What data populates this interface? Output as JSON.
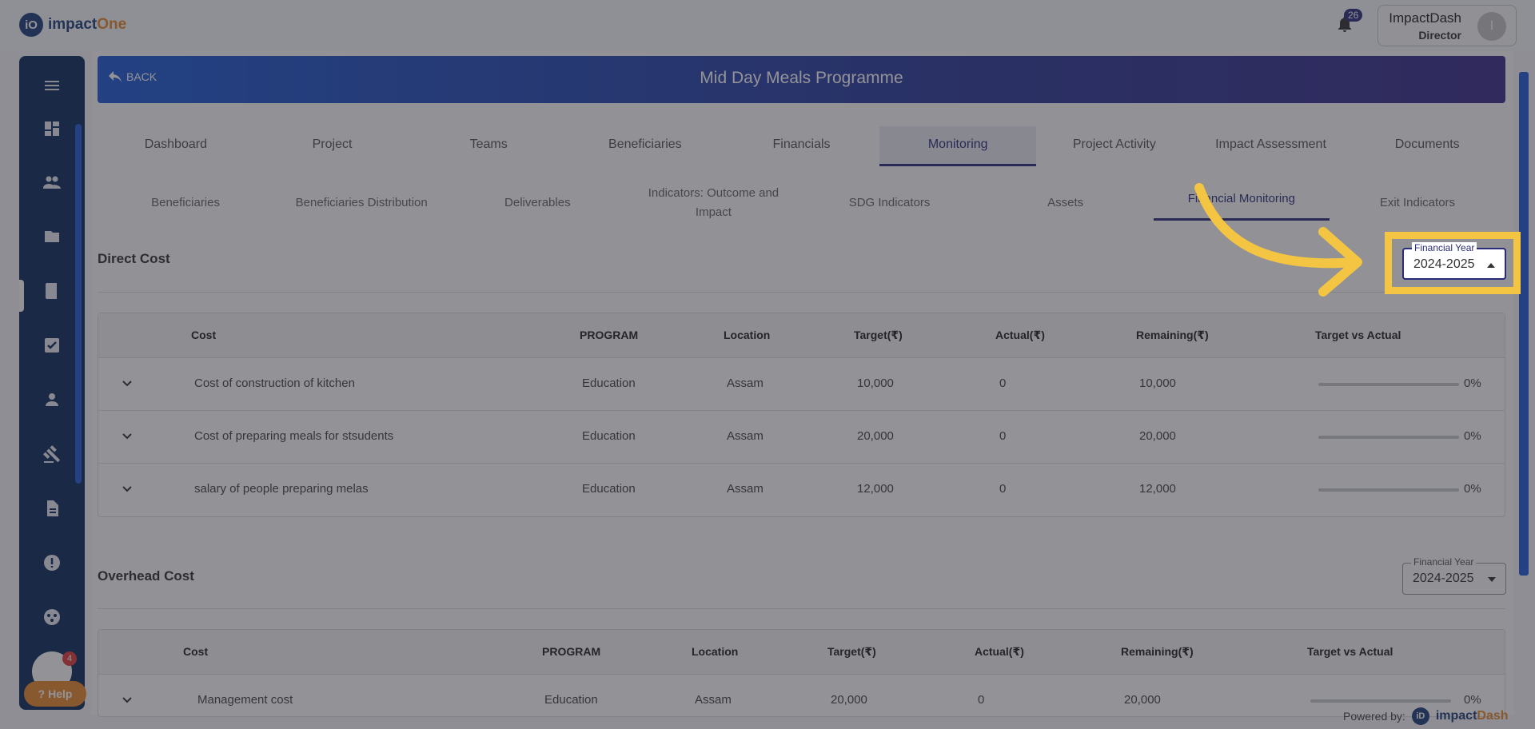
{
  "brand": {
    "logo_initials": "iO",
    "name_part1": "impact",
    "name_part2": "One"
  },
  "topbar": {
    "notification_count": "26",
    "user_name": "ImpactDash",
    "user_role": "Director",
    "avatar_initial": "I"
  },
  "sidebar": {
    "items": [
      "menu-icon",
      "dashboard-icon",
      "users-icon",
      "folder-icon",
      "book-icon",
      "checkbox-icon",
      "person-icon",
      "gavel-icon",
      "document-icon",
      "alert-icon",
      "network-icon"
    ],
    "notification_count": "4",
    "help_label": "Help"
  },
  "header": {
    "back_label": "BACK",
    "title": "Mid Day Meals Programme"
  },
  "main_tabs": [
    {
      "label": "Dashboard"
    },
    {
      "label": "Project"
    },
    {
      "label": "Teams"
    },
    {
      "label": "Beneficiaries"
    },
    {
      "label": "Financials"
    },
    {
      "label": "Monitoring",
      "active": true
    },
    {
      "label": "Project Activity"
    },
    {
      "label": "Impact Assessment"
    },
    {
      "label": "Documents"
    }
  ],
  "sub_tabs": [
    {
      "label": "Beneficiaries"
    },
    {
      "label": "Beneficiaries Distribution"
    },
    {
      "label": "Deliverables"
    },
    {
      "label": "Indicators: Outcome and Impact"
    },
    {
      "label": "SDG Indicators"
    },
    {
      "label": "Assets"
    },
    {
      "label": "Financial Monitoring",
      "active": true
    },
    {
      "label": "Exit Indicators"
    }
  ],
  "direct_cost": {
    "title": "Direct Cost",
    "fy_label": "Financial Year",
    "fy_value": "2024-2025",
    "columns": [
      "Cost",
      "PROGRAM",
      "Location",
      "Target(₹)",
      "Actual(₹)",
      "Remaining(₹)",
      "Target vs Actual"
    ],
    "rows": [
      {
        "cost": "Cost of construction of kitchen",
        "program": "Education",
        "location": "Assam",
        "target": "10,000",
        "actual": "0",
        "remaining": "10,000",
        "progress": 0,
        "progress_label": "0%"
      },
      {
        "cost": "Cost of preparing meals for stsudents",
        "program": "Education",
        "location": "Assam",
        "target": "20,000",
        "actual": "0",
        "remaining": "20,000",
        "progress": 0,
        "progress_label": "0%"
      },
      {
        "cost": "salary of people preparing melas",
        "program": "Education",
        "location": "Assam",
        "target": "12,000",
        "actual": "0",
        "remaining": "12,000",
        "progress": 0,
        "progress_label": "0%"
      }
    ]
  },
  "overhead_cost": {
    "title": "Overhead Cost",
    "fy_label": "Financial Year",
    "fy_value": "2024-2025",
    "columns": [
      "Cost",
      "PROGRAM",
      "Location",
      "Target(₹)",
      "Actual(₹)",
      "Remaining(₹)",
      "Target vs Actual"
    ],
    "rows": [
      {
        "cost": "Management cost",
        "program": "Education",
        "location": "Assam",
        "target": "20,000",
        "actual": "0",
        "remaining": "20,000",
        "progress": 0,
        "progress_label": "0%"
      }
    ]
  },
  "footer": {
    "powered_label": "Powered by:",
    "brand_part1": "impact",
    "brand_part2": "Dash",
    "brand_initials": "iD"
  },
  "colors": {
    "primary": "#2b2d7a",
    "banner_start": "#1e5bd6",
    "accent": "#e88a2e",
    "highlight": "#f4c542",
    "sidebar": "#0c2a5a"
  }
}
